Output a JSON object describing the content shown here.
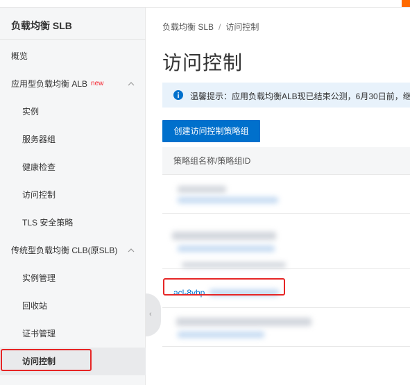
{
  "sidebar": {
    "title": "负载均衡 SLB",
    "items": [
      {
        "label": "概览"
      },
      {
        "label": "应用型负载均衡 ALB",
        "badge": "new"
      },
      {
        "label": "实例"
      },
      {
        "label": "服务器组"
      },
      {
        "label": "健康检查"
      },
      {
        "label": "访问控制"
      },
      {
        "label": "TLS 安全策略"
      },
      {
        "label": "传统型负载均衡 CLB(原SLB)"
      },
      {
        "label": "实例管理"
      },
      {
        "label": "回收站"
      },
      {
        "label": "证书管理"
      },
      {
        "label": "访问控制"
      }
    ]
  },
  "breadcrumb": {
    "root": "负载均衡 SLB",
    "separator": "/",
    "current": "访问控制"
  },
  "page": {
    "title": "访问控制"
  },
  "notice": {
    "text": "温馨提示：应用负载均衡ALB现已结束公测，6月30日前，继"
  },
  "actions": {
    "create_label": "创建访问控制策略组"
  },
  "table": {
    "column_header": "策略组名称/策略组ID",
    "visible_id_prefix": "acl-8vbp"
  },
  "colors": {
    "primary": "#0070cc",
    "highlight": "#e62525",
    "new_badge": "#f5222d",
    "notice_bg": "#e8f2fb",
    "brand": "#ff6a00"
  }
}
